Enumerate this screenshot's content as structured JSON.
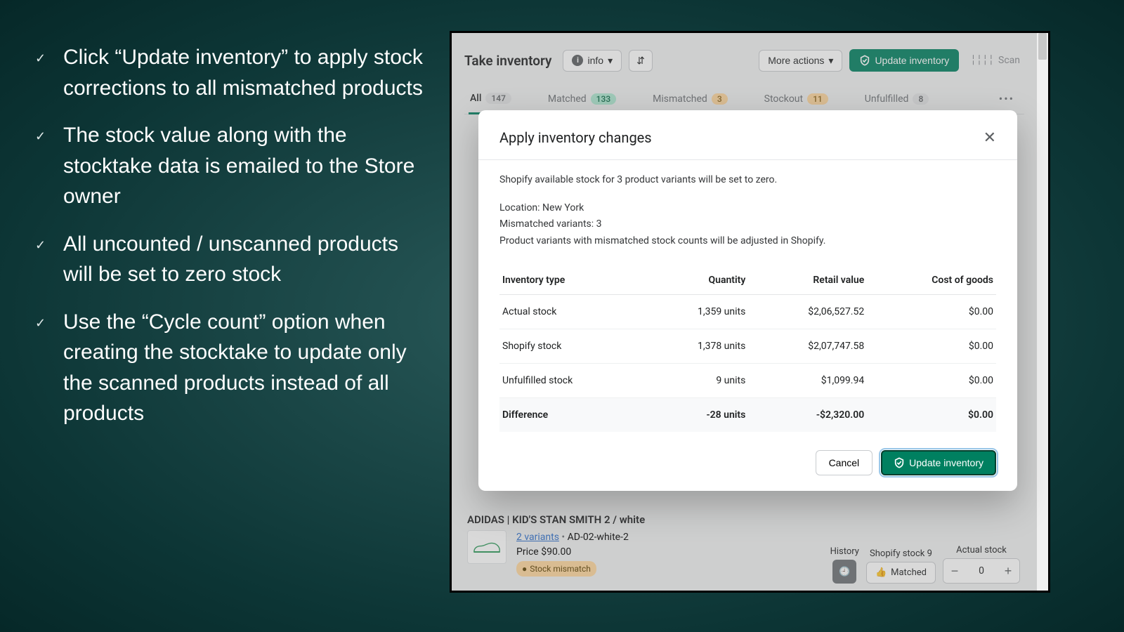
{
  "bullets": [
    "Click “Update inventory” to apply stock corrections to all mismatched products",
    "The stock value along with the stocktake data is emailed to the Store owner",
    "All uncounted / unscanned products will be set to zero stock",
    "Use the “Cycle count” option when creating the stocktake to update only the scanned products instead of all products"
  ],
  "topbar": {
    "title": "Take inventory",
    "info_label": "info",
    "more_actions": "More actions",
    "update_btn": "Update inventory",
    "scan_btn": "Scan"
  },
  "tabs": {
    "all": {
      "label": "All",
      "count": "147"
    },
    "matched": {
      "label": "Matched",
      "count": "133"
    },
    "mismatched": {
      "label": "Mismatched",
      "count": "3"
    },
    "stockout": {
      "label": "Stockout",
      "count": "11"
    },
    "unfulfilled": {
      "label": "Unfulfilled",
      "count": "8"
    }
  },
  "modal": {
    "title": "Apply inventory changes",
    "lead": "Shopify available stock for 3 product variants will be set to zero.",
    "location_line": "Location: New York",
    "mismatch_line": "Mismatched variants: 3",
    "adjust_line": "Product variants with mismatched stock counts will be adjusted in Shopify.",
    "headers": {
      "type": "Inventory type",
      "qty": "Quantity",
      "retail": "Retail value",
      "cogs": "Cost of goods"
    },
    "rows": [
      {
        "type": "Actual stock",
        "qty": "1,359 units",
        "retail": "$2,06,527.52",
        "cogs": "$0.00"
      },
      {
        "type": "Shopify stock",
        "qty": "1,378 units",
        "retail": "$2,07,747.58",
        "cogs": "$0.00"
      },
      {
        "type": "Unfulfilled stock",
        "qty": "9 units",
        "retail": "$1,099.94",
        "cogs": "$0.00"
      }
    ],
    "diff": {
      "type": "Difference",
      "qty": "-28 units",
      "retail": "-$2,320.00",
      "cogs": "$0.00"
    },
    "cancel": "Cancel",
    "update": "Update inventory"
  },
  "product": {
    "title": "ADIDAS | KID'S STAN SMITH 2 / white",
    "variants_link": "2 variants",
    "sku": "AD-02-white-2",
    "price": "Price $90.00",
    "mismatch": "Stock mismatch",
    "history_label": "History",
    "shopify_stock_label": "Shopify stock 9",
    "actual_stock_label": "Actual stock",
    "matched_btn": "Matched",
    "actual_val": "0"
  }
}
